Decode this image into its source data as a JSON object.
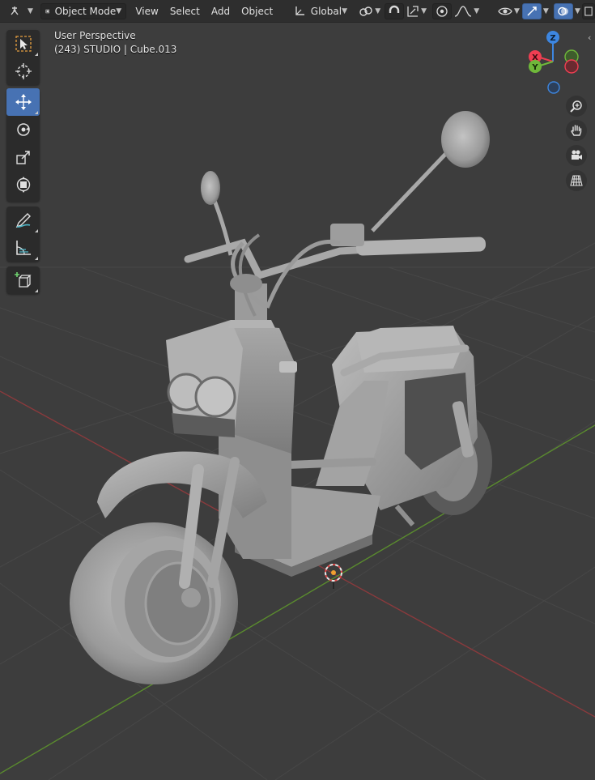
{
  "header": {
    "mode_label": "Object Mode",
    "menus": [
      "View",
      "Select",
      "Add",
      "Object"
    ],
    "transform_orientation": "Global"
  },
  "viewport": {
    "perspective_label": "User Perspective",
    "object_info": "(243) STUDIO | Cube.013"
  },
  "gizmo": {
    "axis_labels": {
      "z": "Z",
      "x": "X",
      "y": "Y"
    },
    "colors": {
      "x": "#f03e52",
      "y": "#6fb83a",
      "z": "#3d86e0"
    }
  },
  "toolbar": {
    "tools": [
      {
        "name": "select-box-tool",
        "icon": "cursor-select-icon",
        "active": false
      },
      {
        "name": "cursor-tool",
        "icon": "3d-cursor-icon",
        "active": false
      },
      {
        "name": "move-tool",
        "icon": "move-arrows-icon",
        "active": true
      },
      {
        "name": "rotate-tool",
        "icon": "rotate-icon",
        "active": false
      },
      {
        "name": "scale-tool",
        "icon": "scale-icon",
        "active": false
      },
      {
        "name": "transform-tool",
        "icon": "transform-icon",
        "active": false
      },
      {
        "name": "annotate-tool",
        "icon": "pencil-icon",
        "active": false
      },
      {
        "name": "measure-tool",
        "icon": "ruler-icon",
        "active": false
      },
      {
        "name": "add-cube-tool",
        "icon": "add-cube-icon",
        "active": false
      }
    ]
  },
  "navigation": [
    "zoom-icon",
    "hand-pan-icon",
    "camera-icon",
    "grid-view-icon"
  ],
  "colors": {
    "accent": "#4772b3",
    "x_axis_line": "#8a3a3d",
    "y_axis_line": "#5a8b2e"
  }
}
